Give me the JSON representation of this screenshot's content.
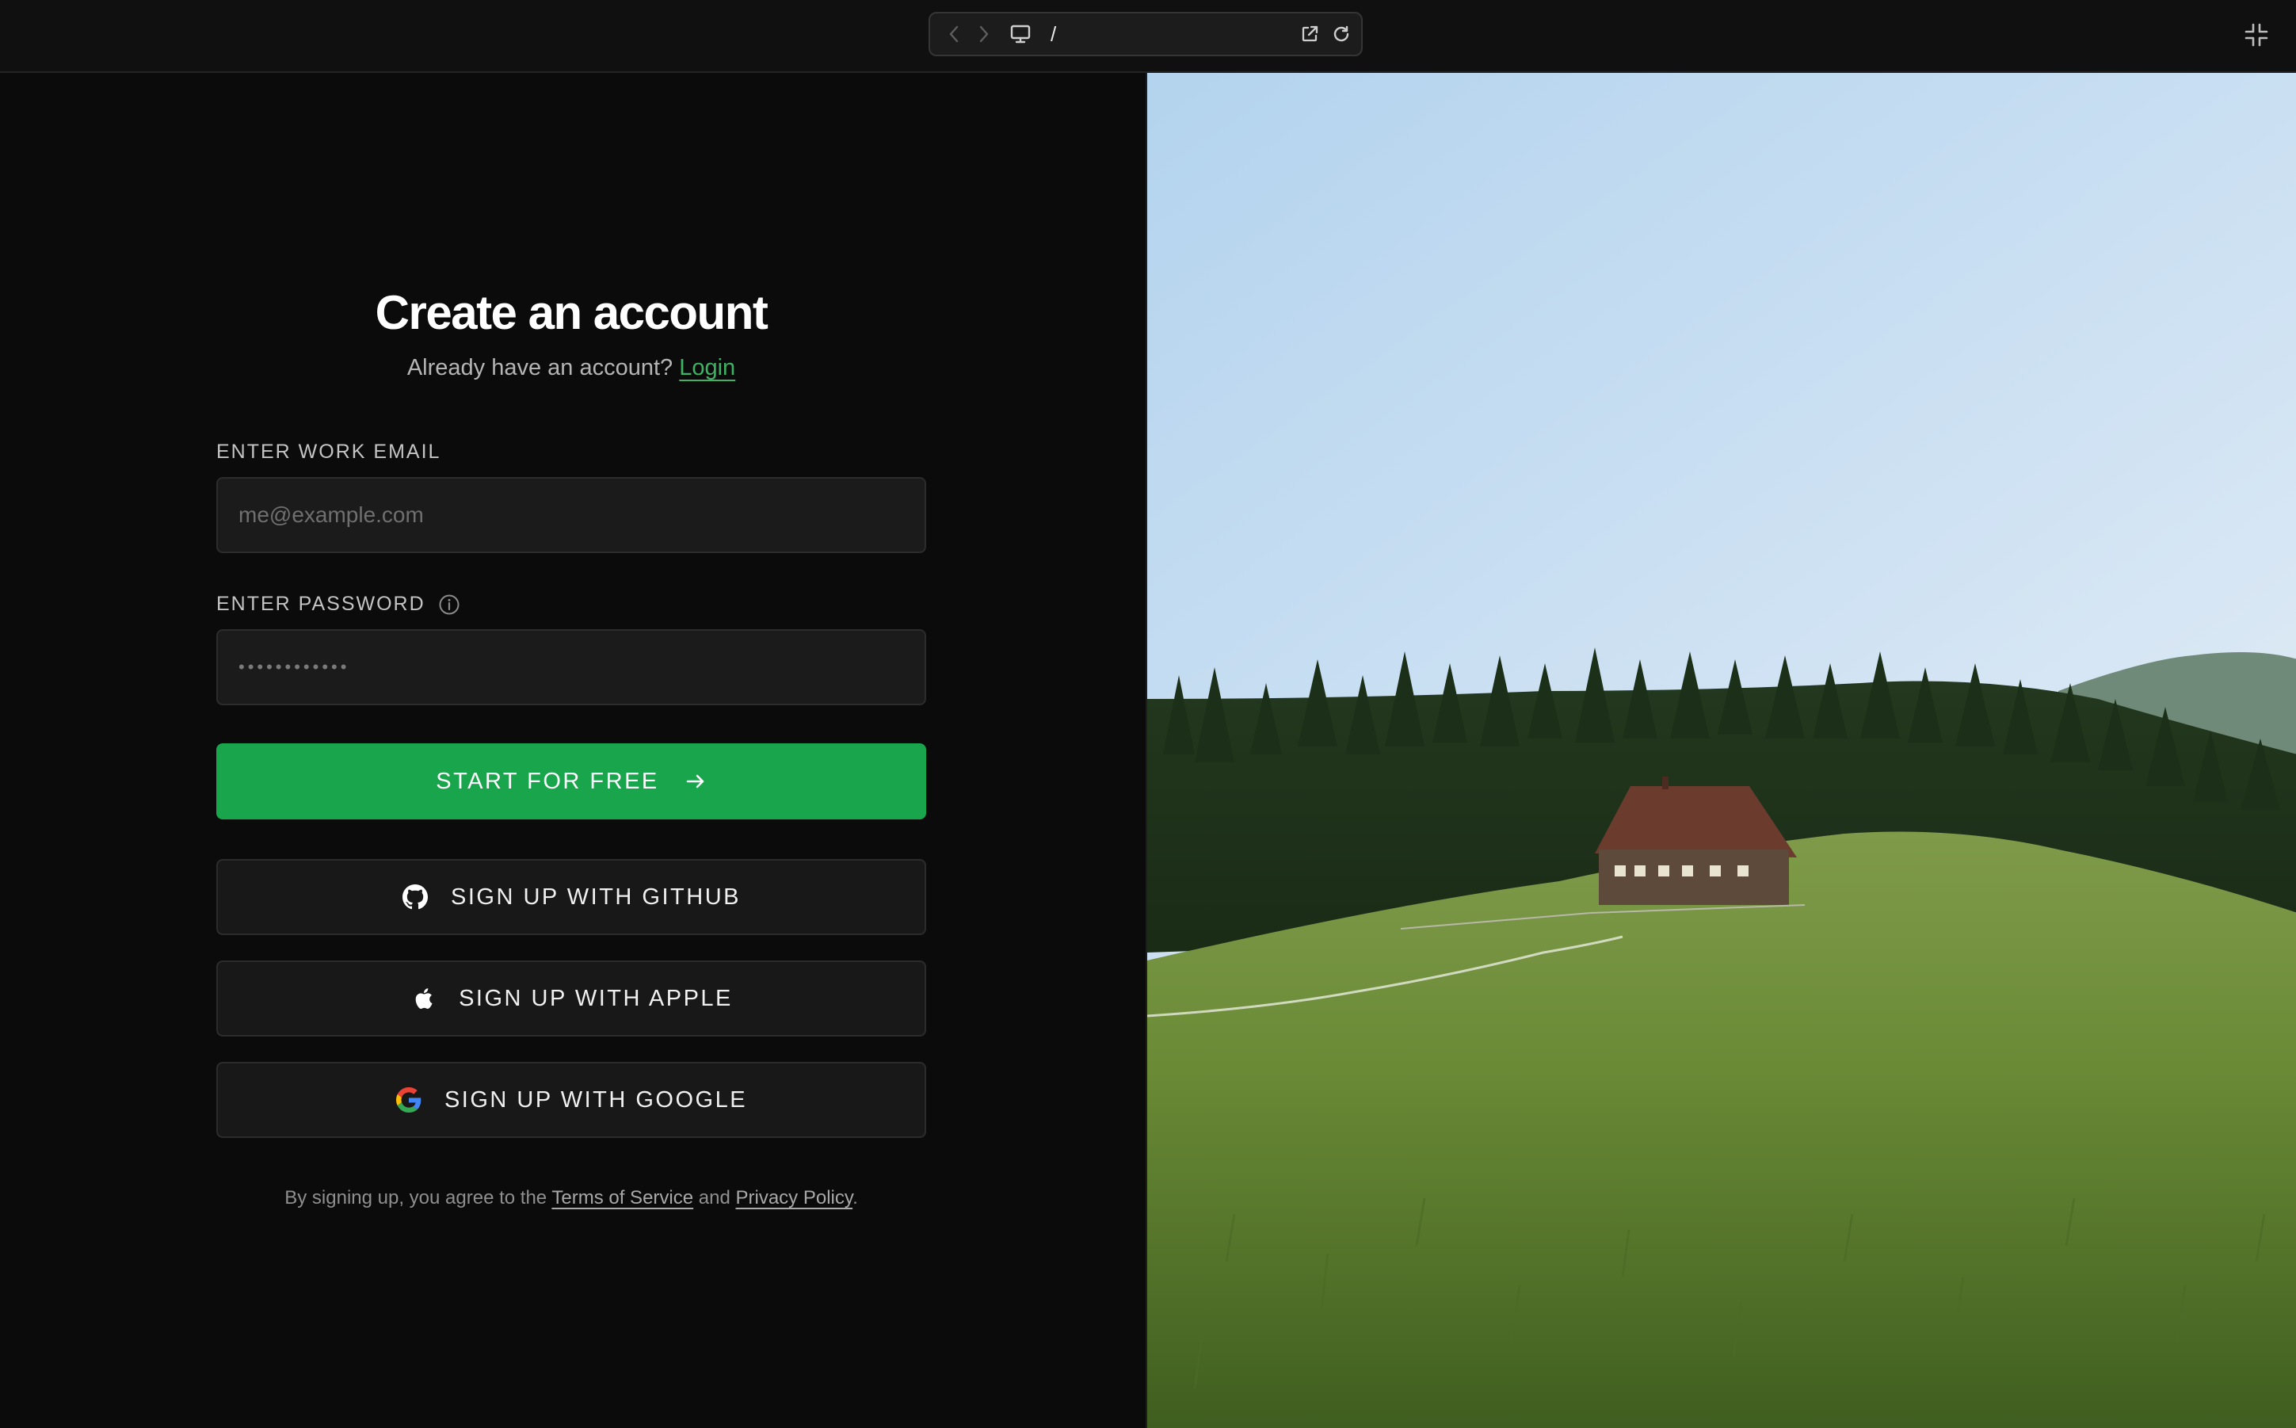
{
  "browser": {
    "path": "/"
  },
  "form": {
    "title": "Create an account",
    "subtitle_prefix": "Already have an account?",
    "login_link": "Login",
    "email_label": "ENTER WORK EMAIL",
    "email_placeholder": "me@example.com",
    "email_value": "",
    "password_label": "ENTER PASSWORD",
    "password_placeholder": "••••••••••••",
    "password_value": "",
    "primary_button": "START FOR FREE",
    "github_button": "SIGN UP WITH GITHUB",
    "apple_button": "SIGN UP WITH APPLE",
    "google_button": "SIGN UP WITH GOOGLE"
  },
  "legal": {
    "prefix": "By signing up, you agree to the",
    "terms": "Terms of Service",
    "and": "and",
    "privacy": "Privacy Policy",
    "suffix": "."
  },
  "colors": {
    "accent": "#18a54c",
    "link": "#3fb364",
    "background": "#0b0b0b"
  },
  "icons": {
    "nav_back": "chevron-left-icon",
    "nav_forward": "chevron-right-icon",
    "device": "monitor-icon",
    "open_external": "external-link-icon",
    "reload": "reload-icon",
    "exit_fullscreen": "minimize-icon",
    "password_info": "info-icon",
    "primary_arrow": "arrow-right-icon",
    "github": "github-icon",
    "apple": "apple-icon",
    "google": "google-icon"
  }
}
